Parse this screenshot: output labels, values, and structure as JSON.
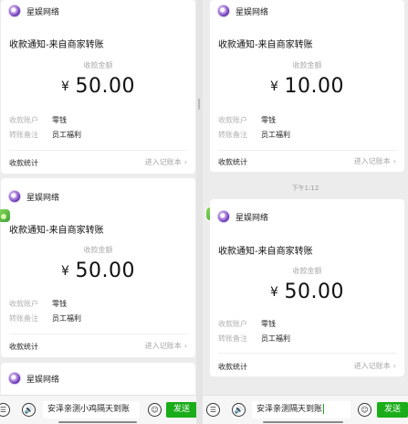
{
  "brand": {
    "name": "星娱网络"
  },
  "card_text": {
    "title": "收款通知-来自商家转账",
    "amount_label": "收款金额",
    "currency": "¥",
    "account_key": "收款账户",
    "account_value": "零钱",
    "remark_key": "转账备注",
    "remark_value": "员工福利",
    "stats_label": "收款统计",
    "ledger_link": "进入记账本",
    "chevron": "›"
  },
  "left_cards": [
    {
      "amount": "50.00"
    },
    {
      "amount": "50.00"
    }
  ],
  "right_cards": [
    {
      "amount": "10.00"
    },
    {
      "amount": "50.00"
    }
  ],
  "right_timestamp": "下午1:12",
  "input_bar": {
    "voice_glyph": "🔊",
    "menu_glyph": "☰",
    "emoji_glyph": "☺",
    "left_text": "安泽亲测小鸡隔天到账",
    "right_text": "安泽亲测隔天到账",
    "send_label": "发送"
  }
}
